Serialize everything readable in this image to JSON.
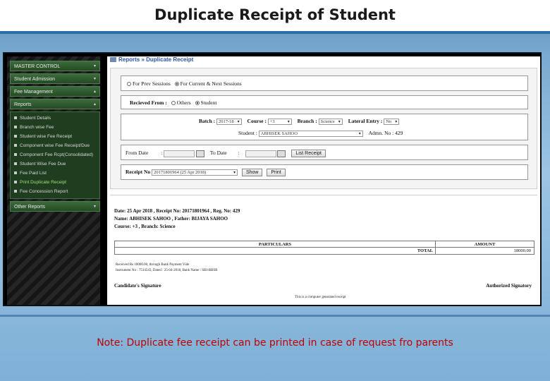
{
  "slide": {
    "title": "Duplicate Receipt of Student",
    "note": "Note: Duplicate fee receipt can be printed in case of request fro parents"
  },
  "sidebar": {
    "items": [
      {
        "label": "MASTER CONTROL",
        "caret": "▾"
      },
      {
        "label": "Student Admission",
        "caret": "▾"
      },
      {
        "label": "Fee Management",
        "caret": "▴"
      },
      {
        "label": "Reports",
        "caret": "▴"
      }
    ],
    "sub_items": [
      {
        "label": "Student Details"
      },
      {
        "label": "Branch wise Fee"
      },
      {
        "label": "Student wise Fee Receipt"
      },
      {
        "label": "Component wise Fee Receipt/Due"
      },
      {
        "label": "Component Fee Rcpt(Consolidated)"
      },
      {
        "label": "Student Wise Fee Due"
      },
      {
        "label": "Fee Paid List"
      },
      {
        "label": "Print Duplicate Receipt"
      },
      {
        "label": "Fee Concession Report"
      }
    ],
    "other_reports": {
      "label": "Other Reports",
      "caret": "▾"
    }
  },
  "breadcrumb": "Reports » Duplicate Receipt",
  "form": {
    "session_prev": "For Prev Sessions",
    "session_current": "For Current & Next Sessions",
    "received_from_label": "Recieved From :",
    "received_others": "Others",
    "received_student": "Student",
    "batch_label": "Batch :",
    "batch_value": "2017-18",
    "course_label": "Course :",
    "course_value": "+3",
    "branch_label": "Branch :",
    "branch_value": "Science",
    "lateral_label": "Lateral Entry :",
    "lateral_value": "No",
    "student_label": "Student :",
    "student_value": "ABHISEK SAHOO",
    "admn_label": "Admn. No :",
    "admn_value": "429",
    "from_date_label": "From Date",
    "to_date_label": "To Date",
    "colon": ":",
    "list_receipt_button": "List Receipt",
    "receipt_no_label": "Receipt No",
    "receipt_no_value": "20171801964 (25 Apr 2018)",
    "show_button": "Show",
    "print_button": "Print"
  },
  "receipt": {
    "line1": "Date: 25 Apr 2018 , Receipt No: 20171801964 , Reg. No: 429",
    "line2": "Name: ABHISEK SAHOO , Father: BIJAYA SAHOO",
    "line3": "Course: +3 , Branch: Science",
    "col_particulars": "PARTICULARS",
    "col_amount": "AMOUNT",
    "total_label": "TOTAL",
    "total_value": "18000.00",
    "payment_line1": "Received Rs 18000.00, through Bank Payment Vide",
    "payment_line2": "Instrument No : 7514543, Dated : 25-04-2018, Bank Name : SBI-BBSR",
    "candidate_signature": "Candidate's Signature",
    "authorized_signatory": "Authorized Signatory",
    "footer": "This is a computer generated receipt"
  }
}
